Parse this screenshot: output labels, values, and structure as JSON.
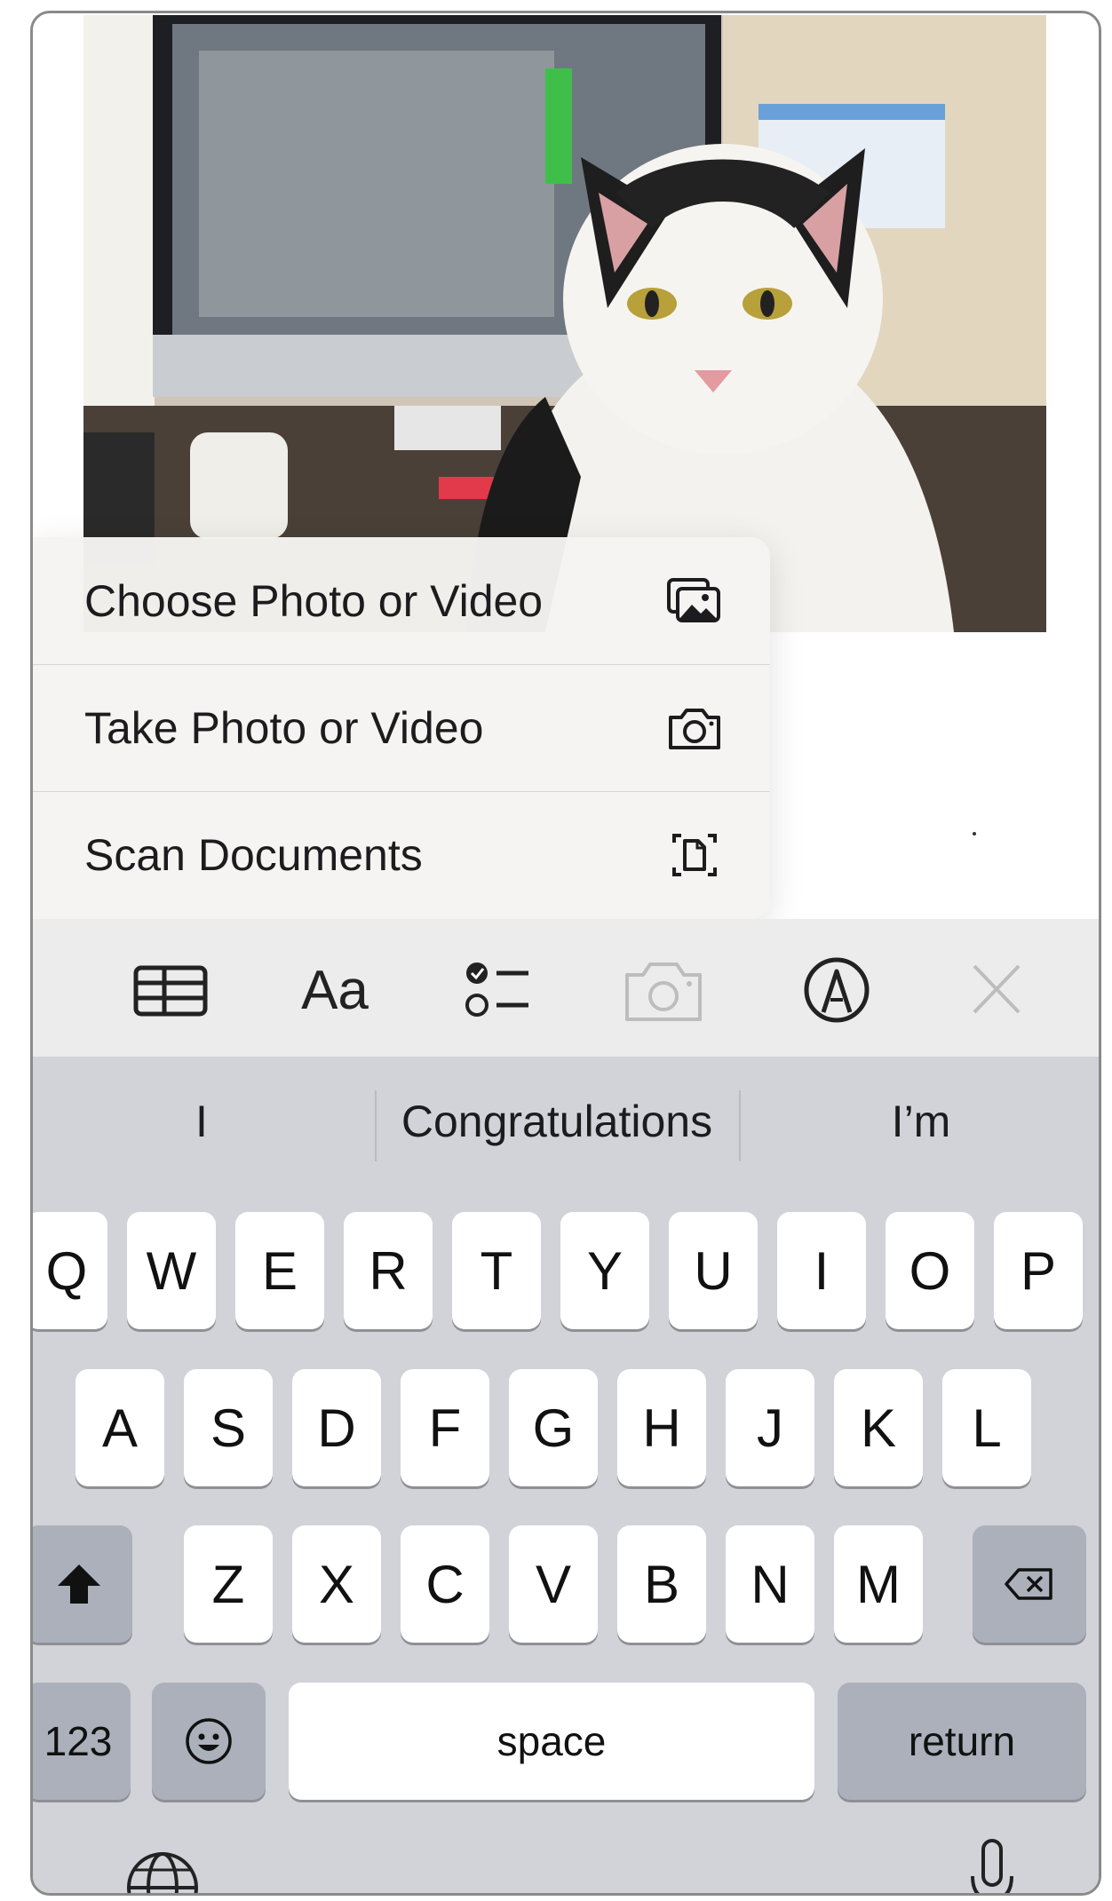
{
  "menu": {
    "items": [
      {
        "label": "Choose Photo or Video",
        "icon": "photo-library-icon"
      },
      {
        "label": "Take Photo or Video",
        "icon": "camera-icon"
      },
      {
        "label": "Scan Documents",
        "icon": "scan-document-icon"
      }
    ]
  },
  "toolbar": {
    "table_icon": "table-icon",
    "format_label": "Aa",
    "checklist_icon": "checklist-icon",
    "camera_icon": "camera-icon",
    "markup_icon": "markup-pen-icon",
    "close_icon": "close-icon"
  },
  "keyboard": {
    "predictions": [
      "I",
      "Congratulations",
      "I’m"
    ],
    "row1": [
      "Q",
      "W",
      "E",
      "R",
      "T",
      "Y",
      "U",
      "I",
      "O",
      "P"
    ],
    "row2": [
      "A",
      "S",
      "D",
      "F",
      "G",
      "H",
      "J",
      "K",
      "L"
    ],
    "row3": [
      "Z",
      "X",
      "C",
      "V",
      "B",
      "N",
      "M"
    ],
    "numbers_label": "123",
    "space_label": "space",
    "return_label": "return",
    "shift_icon": "shift-icon",
    "delete_icon": "delete-icon",
    "emoji_icon": "emoji-icon",
    "globe_icon": "globe-icon",
    "mic_icon": "microphone-icon"
  },
  "colors": {
    "keyboard_bg": "#d1d3d9",
    "key_bg": "#ffffff",
    "dark_key_bg": "#abb0ba",
    "toolbar_bg": "#ececec"
  }
}
